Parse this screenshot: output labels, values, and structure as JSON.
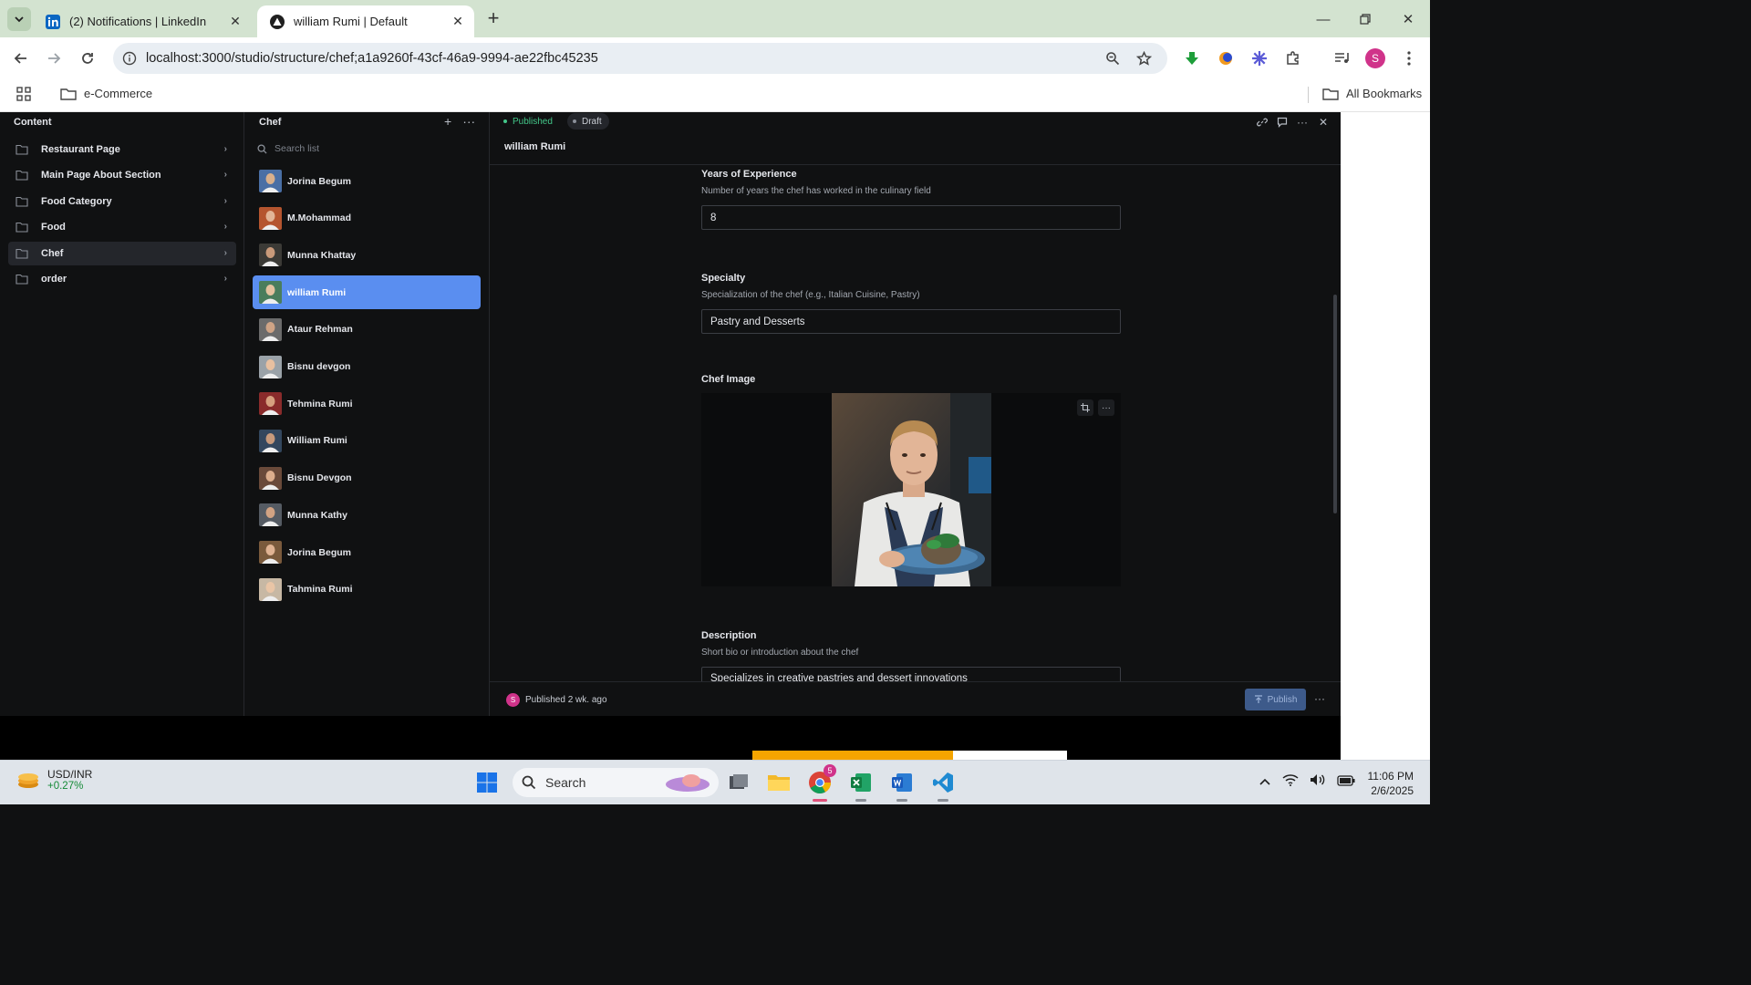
{
  "browser": {
    "tabs": [
      {
        "title": "(2) Notifications | LinkedIn",
        "active": false
      },
      {
        "title": "william Rumi | Default",
        "active": true
      }
    ],
    "url": "localhost:3000/studio/structure/chef;a1a9260f-43cf-46a9-9994-ae22fbc45235",
    "profile_initial": "S",
    "bookmarks": {
      "folder": "e-Commerce",
      "all": "All Bookmarks"
    }
  },
  "content_pane": {
    "title": "Content",
    "items": [
      {
        "label": "Restaurant Page"
      },
      {
        "label": "Main Page About Section"
      },
      {
        "label": "Food Category"
      },
      {
        "label": "Food"
      },
      {
        "label": "Chef",
        "active": true
      },
      {
        "label": "order"
      }
    ]
  },
  "chef_pane": {
    "title": "Chef",
    "search_placeholder": "Search list",
    "items": [
      {
        "name": "Jorina Begum"
      },
      {
        "name": "M.Mohammad"
      },
      {
        "name": "Munna Khattay"
      },
      {
        "name": "william Rumi",
        "active": true
      },
      {
        "name": "Ataur Rehman"
      },
      {
        "name": "Bisnu devgon"
      },
      {
        "name": "Tehmina Rumi"
      },
      {
        "name": "William Rumi"
      },
      {
        "name": "Bisnu Devgon"
      },
      {
        "name": "Munna Kathy"
      },
      {
        "name": "Jorina Begum"
      },
      {
        "name": "Tahmina Rumi"
      }
    ]
  },
  "document": {
    "status_published": "Published",
    "status_draft": "Draft",
    "title": "william Rumi",
    "fields": {
      "experience": {
        "label": "Years of Experience",
        "description": "Number of years the chef has worked in the culinary field",
        "value": "8"
      },
      "specialty": {
        "label": "Specialty",
        "description": "Specialization of the chef (e.g., Italian Cuisine, Pastry)",
        "value": "Pastry and Desserts"
      },
      "image": {
        "label": "Chef Image"
      },
      "description": {
        "label": "Description",
        "description": "Short bio or introduction about the chef",
        "value": "Specializes in creative pastries and dessert innovations"
      }
    },
    "footer": {
      "avatar_initial": "S",
      "status": "Published 2 wk. ago",
      "publish_label": "Publish"
    }
  },
  "taskbar": {
    "ticker_symbol": "USD/INR",
    "ticker_change": "+0.27%",
    "search_label": "Search",
    "chrome_badge": "5",
    "time": "11:06 PM",
    "date": "2/6/2025"
  },
  "colors": {
    "accent": "#5a8ef0",
    "published": "#43c789",
    "studio_bg": "#101112"
  }
}
